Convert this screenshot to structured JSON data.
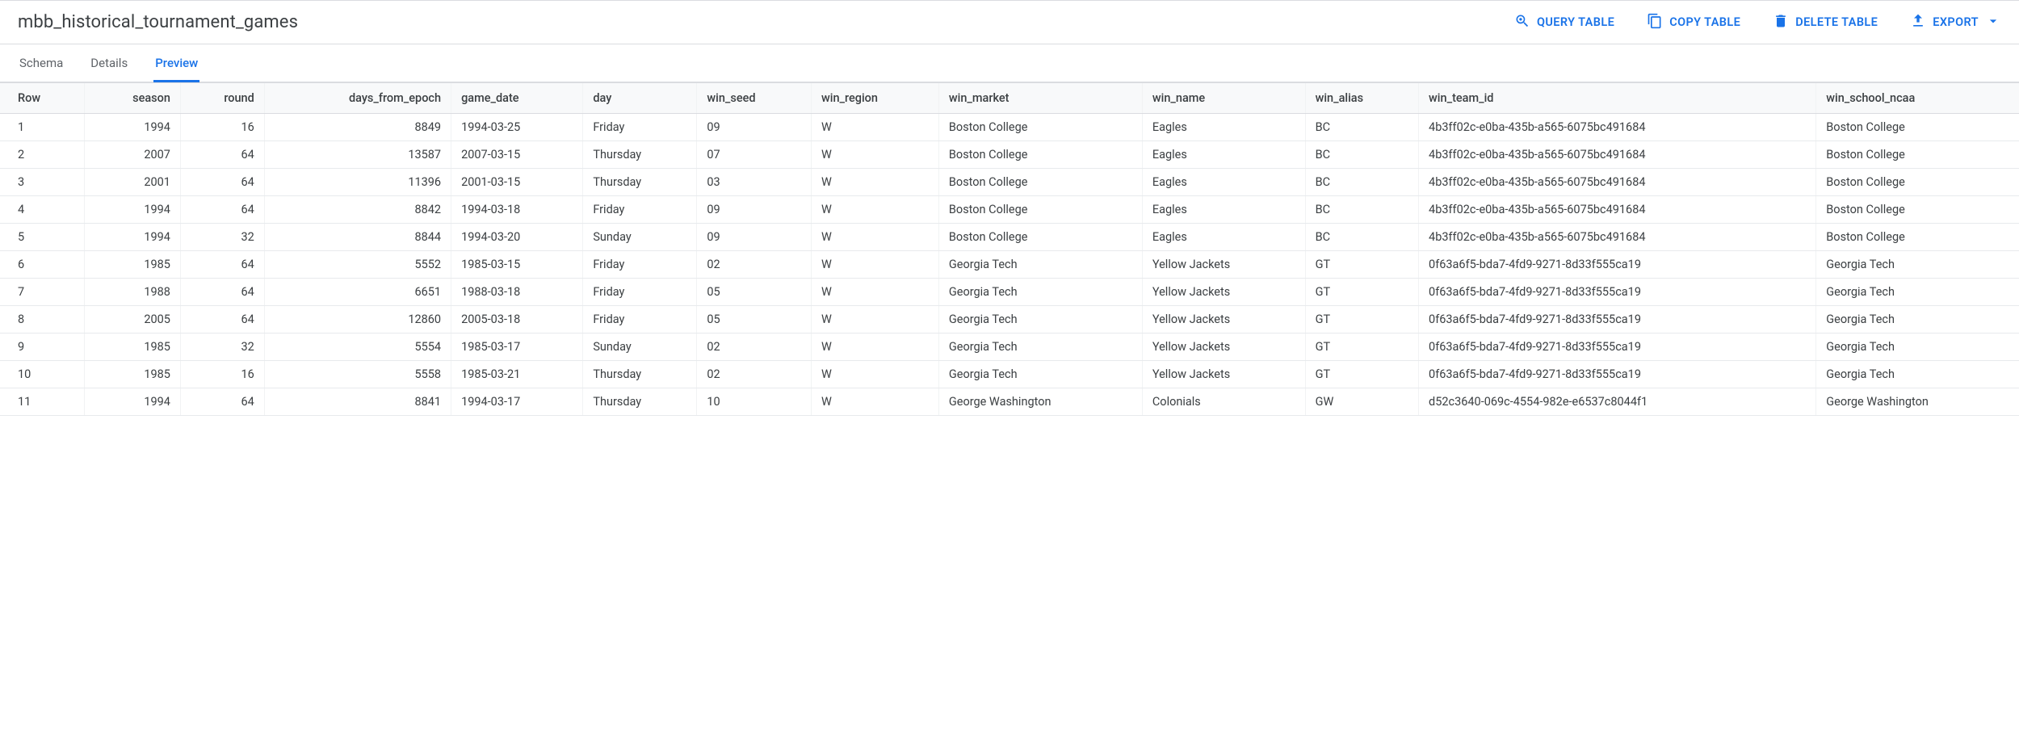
{
  "header": {
    "title": "mbb_historical_tournament_games",
    "actions": {
      "query": "QUERY TABLE",
      "copy": "COPY TABLE",
      "delete": "DELETE TABLE",
      "export": "EXPORT"
    }
  },
  "tabs": {
    "schema": "Schema",
    "details": "Details",
    "preview": "Preview"
  },
  "table": {
    "columns": [
      "Row",
      "season",
      "round",
      "days_from_epoch",
      "game_date",
      "day",
      "win_seed",
      "win_region",
      "win_market",
      "win_name",
      "win_alias",
      "win_team_id",
      "win_school_ncaa"
    ],
    "rows": [
      {
        "row": "1",
        "season": "1994",
        "round": "16",
        "days_from_epoch": "8849",
        "game_date": "1994-03-25",
        "day": "Friday",
        "win_seed": "09",
        "win_region": "W",
        "win_market": "Boston College",
        "win_name": "Eagles",
        "win_alias": "BC",
        "win_team_id": "4b3ff02c-e0ba-435b-a565-6075bc491684",
        "win_school_ncaa": "Boston College"
      },
      {
        "row": "2",
        "season": "2007",
        "round": "64",
        "days_from_epoch": "13587",
        "game_date": "2007-03-15",
        "day": "Thursday",
        "win_seed": "07",
        "win_region": "W",
        "win_market": "Boston College",
        "win_name": "Eagles",
        "win_alias": "BC",
        "win_team_id": "4b3ff02c-e0ba-435b-a565-6075bc491684",
        "win_school_ncaa": "Boston College"
      },
      {
        "row": "3",
        "season": "2001",
        "round": "64",
        "days_from_epoch": "11396",
        "game_date": "2001-03-15",
        "day": "Thursday",
        "win_seed": "03",
        "win_region": "W",
        "win_market": "Boston College",
        "win_name": "Eagles",
        "win_alias": "BC",
        "win_team_id": "4b3ff02c-e0ba-435b-a565-6075bc491684",
        "win_school_ncaa": "Boston College"
      },
      {
        "row": "4",
        "season": "1994",
        "round": "64",
        "days_from_epoch": "8842",
        "game_date": "1994-03-18",
        "day": "Friday",
        "win_seed": "09",
        "win_region": "W",
        "win_market": "Boston College",
        "win_name": "Eagles",
        "win_alias": "BC",
        "win_team_id": "4b3ff02c-e0ba-435b-a565-6075bc491684",
        "win_school_ncaa": "Boston College"
      },
      {
        "row": "5",
        "season": "1994",
        "round": "32",
        "days_from_epoch": "8844",
        "game_date": "1994-03-20",
        "day": "Sunday",
        "win_seed": "09",
        "win_region": "W",
        "win_market": "Boston College",
        "win_name": "Eagles",
        "win_alias": "BC",
        "win_team_id": "4b3ff02c-e0ba-435b-a565-6075bc491684",
        "win_school_ncaa": "Boston College"
      },
      {
        "row": "6",
        "season": "1985",
        "round": "64",
        "days_from_epoch": "5552",
        "game_date": "1985-03-15",
        "day": "Friday",
        "win_seed": "02",
        "win_region": "W",
        "win_market": "Georgia Tech",
        "win_name": "Yellow Jackets",
        "win_alias": "GT",
        "win_team_id": "0f63a6f5-bda7-4fd9-9271-8d33f555ca19",
        "win_school_ncaa": "Georgia Tech"
      },
      {
        "row": "7",
        "season": "1988",
        "round": "64",
        "days_from_epoch": "6651",
        "game_date": "1988-03-18",
        "day": "Friday",
        "win_seed": "05",
        "win_region": "W",
        "win_market": "Georgia Tech",
        "win_name": "Yellow Jackets",
        "win_alias": "GT",
        "win_team_id": "0f63a6f5-bda7-4fd9-9271-8d33f555ca19",
        "win_school_ncaa": "Georgia Tech"
      },
      {
        "row": "8",
        "season": "2005",
        "round": "64",
        "days_from_epoch": "12860",
        "game_date": "2005-03-18",
        "day": "Friday",
        "win_seed": "05",
        "win_region": "W",
        "win_market": "Georgia Tech",
        "win_name": "Yellow Jackets",
        "win_alias": "GT",
        "win_team_id": "0f63a6f5-bda7-4fd9-9271-8d33f555ca19",
        "win_school_ncaa": "Georgia Tech"
      },
      {
        "row": "9",
        "season": "1985",
        "round": "32",
        "days_from_epoch": "5554",
        "game_date": "1985-03-17",
        "day": "Sunday",
        "win_seed": "02",
        "win_region": "W",
        "win_market": "Georgia Tech",
        "win_name": "Yellow Jackets",
        "win_alias": "GT",
        "win_team_id": "0f63a6f5-bda7-4fd9-9271-8d33f555ca19",
        "win_school_ncaa": "Georgia Tech"
      },
      {
        "row": "10",
        "season": "1985",
        "round": "16",
        "days_from_epoch": "5558",
        "game_date": "1985-03-21",
        "day": "Thursday",
        "win_seed": "02",
        "win_region": "W",
        "win_market": "Georgia Tech",
        "win_name": "Yellow Jackets",
        "win_alias": "GT",
        "win_team_id": "0f63a6f5-bda7-4fd9-9271-8d33f555ca19",
        "win_school_ncaa": "Georgia Tech"
      },
      {
        "row": "11",
        "season": "1994",
        "round": "64",
        "days_from_epoch": "8841",
        "game_date": "1994-03-17",
        "day": "Thursday",
        "win_seed": "10",
        "win_region": "W",
        "win_market": "George Washington",
        "win_name": "Colonials",
        "win_alias": "GW",
        "win_team_id": "d52c3640-069c-4554-982e-e6537c8044f1",
        "win_school_ncaa": "George Washington"
      }
    ]
  }
}
